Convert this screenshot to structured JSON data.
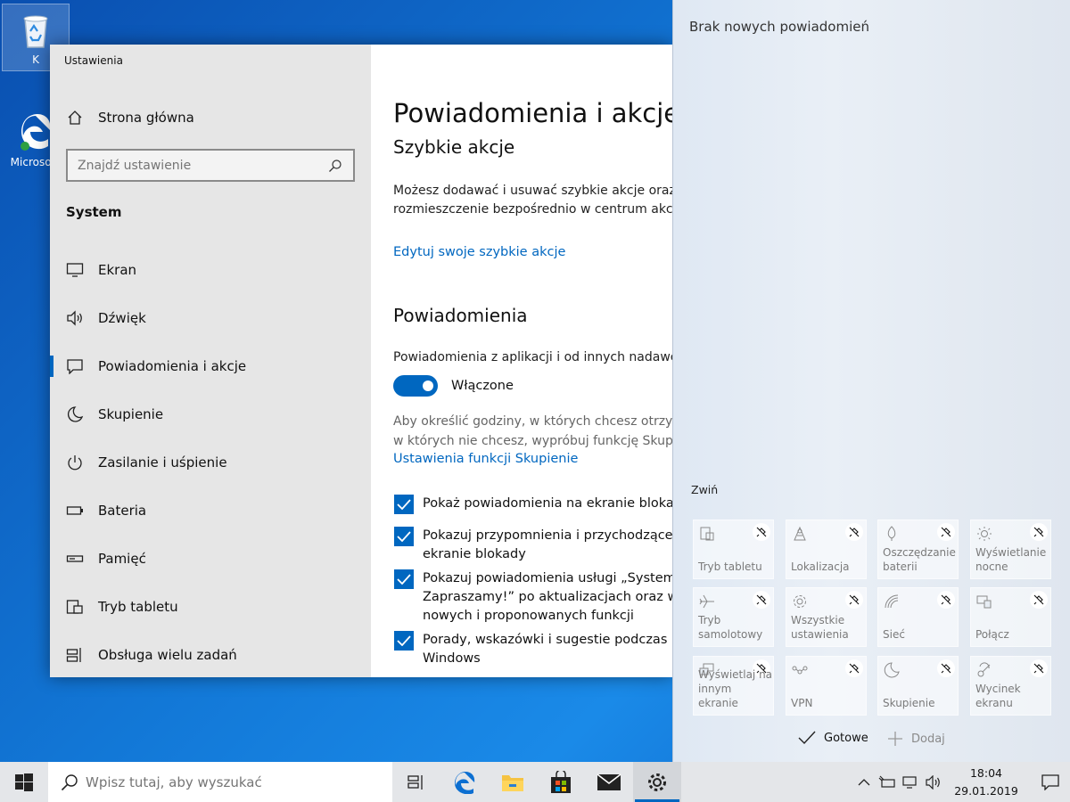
{
  "desktop": {
    "recycle_label": "K",
    "edge_label": "Microso k"
  },
  "settings": {
    "window_title": "Ustawienia",
    "home_label": "Strona główna",
    "search_placeholder": "Znajdź ustawienie",
    "section_label": "System",
    "nav": [
      {
        "label": "Ekran",
        "icon": "monitor-icon"
      },
      {
        "label": "Dźwięk",
        "icon": "speaker-icon"
      },
      {
        "label": "Powiadomienia i akcje",
        "icon": "message-icon",
        "active": true
      },
      {
        "label": "Skupienie",
        "icon": "moon-icon"
      },
      {
        "label": "Zasilanie i uśpienie",
        "icon": "power-icon"
      },
      {
        "label": "Bateria",
        "icon": "battery-icon"
      },
      {
        "label": "Pamięć",
        "icon": "storage-icon"
      },
      {
        "label": "Tryb tabletu",
        "icon": "tablet-icon"
      },
      {
        "label": "Obsługa wielu zadań",
        "icon": "multitask-icon"
      }
    ],
    "page_title": "Powiadomienia i akcje",
    "quick_actions_heading": "Szybkie akcje",
    "quick_desc_1": "Możesz dodawać i usuwać szybkie akcje oraz z",
    "quick_desc_2": "rozmieszczenie bezpośrednio w centrum akcji",
    "edit_quick_link": "Edytuj swoje szybkie akcje",
    "notifications_heading": "Powiadomienia",
    "notif_from_apps": "Powiadomienia z aplikacji i od innych nadawców",
    "toggle_state": "Włączone",
    "focus_desc_1": "Aby określić godziny, w których chcesz otrzym",
    "focus_desc_2": "w których nie chcesz, wypróbuj funkcję Skupie",
    "focus_link": "Ustawienia funkcji Skupienie",
    "checkboxes": [
      {
        "lines": [
          "Pokaż powiadomienia na ekranie blokady"
        ],
        "checked": true
      },
      {
        "lines": [
          "Pokazuj przypomnienia i przychodzące p",
          "ekranie blokady"
        ],
        "checked": true
      },
      {
        "lines": [
          "Pokazuj powiadomienia usługi „System W",
          "Zapraszamy!” po aktualizacjach oraz w c",
          "nowych i proponowanych funkcji"
        ],
        "checked": true
      },
      {
        "lines": [
          "Porady, wskazówki i sugestie podczas ko",
          "Windows"
        ],
        "checked": true
      }
    ]
  },
  "action_center": {
    "no_notifications": "Brak nowych powiadomień",
    "collapse_label": "Zwiń",
    "tiles": [
      {
        "label": "Tryb tabletu",
        "icon": "tablet-mode-icon"
      },
      {
        "label": "Lokalizacja",
        "icon": "location-icon"
      },
      {
        "label": "Oszczędzanie\nbaterii",
        "icon": "battery-saver-icon"
      },
      {
        "label": "Wyświetlanie\nnocne",
        "icon": "night-light-icon"
      },
      {
        "label": "Tryb\nsamolotowy",
        "icon": "airplane-icon"
      },
      {
        "label": "Wszystkie\nustawienia",
        "icon": "gear-icon"
      },
      {
        "label": "Sieć",
        "icon": "network-icon"
      },
      {
        "label": "Połącz",
        "icon": "connect-icon"
      },
      {
        "label": "Wyświetlaj na\ninnym ekranie",
        "icon": "project-icon"
      },
      {
        "label": "VPN",
        "icon": "vpn-icon"
      },
      {
        "label": "Skupienie",
        "icon": "focus-moon-icon"
      },
      {
        "label": "Wycinek\nekranu",
        "icon": "snip-icon"
      }
    ],
    "done_label": "Gotowe",
    "add_label": "Dodaj"
  },
  "taskbar": {
    "search_placeholder": "Wpisz tutaj, aby wyszukać",
    "time": "18:04",
    "date": "29.01.2019",
    "accent": "#0067c0"
  }
}
